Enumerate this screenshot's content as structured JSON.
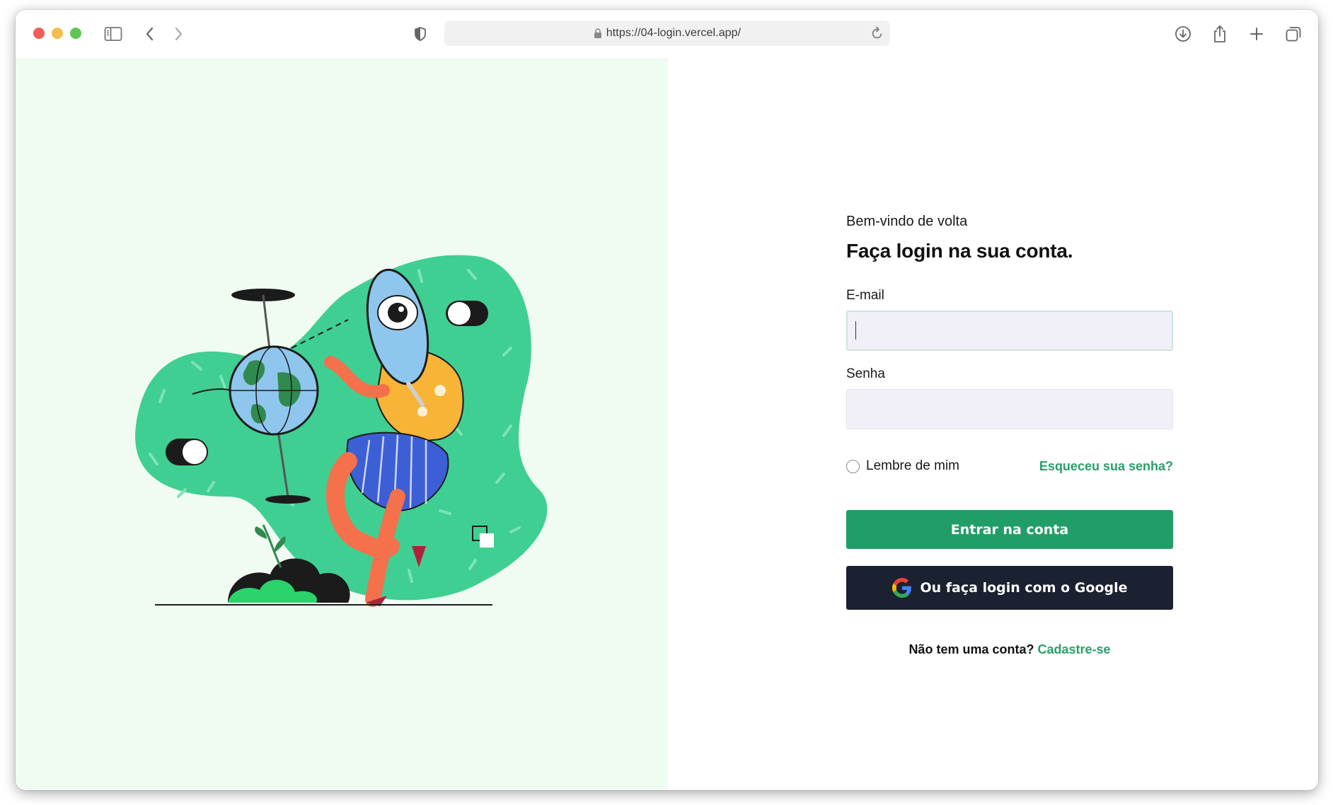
{
  "browser": {
    "url": "https://04-login.vercel.app/"
  },
  "login": {
    "greeting": "Bem-vindo de volta",
    "heading": "Faça login na sua conta.",
    "email_label": "E-mail",
    "email_value": "",
    "password_label": "Senha",
    "password_value": "",
    "remember_label": "Lembre de mim",
    "forgot_link": "Esqueceu sua senha?",
    "submit_label": "Entrar na conta",
    "google_label": "Ou faça login com o Google",
    "signup_prompt": "Não tem uma conta?",
    "signup_link": "Cadastre-se"
  },
  "colors": {
    "accent": "#219e67",
    "link": "#27a06a",
    "dark_button": "#1b2130",
    "left_bg": "#f0fcf2",
    "blob": "#3fcf93"
  }
}
